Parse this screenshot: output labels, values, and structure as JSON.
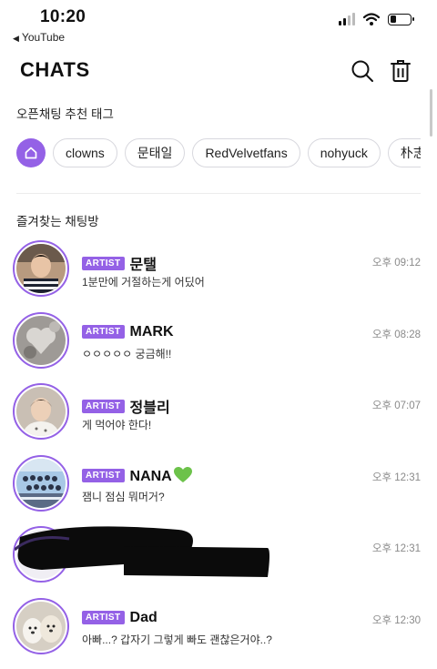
{
  "status_bar": {
    "time": "10:20",
    "back_app": "YouTube"
  },
  "header": {
    "title": "CHATS"
  },
  "tags": {
    "title": "오픈채팅 추천 태그",
    "items": [
      "clowns",
      "문태일",
      "RedVelvetfans",
      "nohyuck",
      "朴志晟"
    ]
  },
  "favorites": {
    "title": "즐겨찾는 채팅방"
  },
  "chats": [
    {
      "badge": "ARTIST",
      "name": "문탤",
      "preview": "1분만에 거절하는게 어딨어",
      "time": "오후 09:12"
    },
    {
      "badge": "ARTIST",
      "name": "MARK",
      "preview": "ㅇㅇㅇㅇㅇ 궁금해!!",
      "time": "오후 08:28"
    },
    {
      "badge": "ARTIST",
      "name": "정블리",
      "preview": "게 먹어야 한다!",
      "time": "오후 07:07"
    },
    {
      "badge": "ARTIST",
      "name": "NANA",
      "preview": "잼니 점심 뭐머거?",
      "time": "오후 12:31"
    },
    {
      "badge": "",
      "name": "",
      "preview": "",
      "time": "오후 12:31"
    },
    {
      "badge": "ARTIST",
      "name": "Dad",
      "preview": "아빠...? 갑자기 그렇게 빠도 괜찮은거야..?",
      "time": "오후 12:30"
    }
  ],
  "colors": {
    "accent": "#9461e6",
    "time_text": "#8a8a8a"
  },
  "icons": [
    "youtube-back-arrow-icon",
    "signal-icon",
    "wifi-icon",
    "battery-icon",
    "search-icon",
    "trash-icon",
    "home-icon",
    "green-heart-icon"
  ]
}
